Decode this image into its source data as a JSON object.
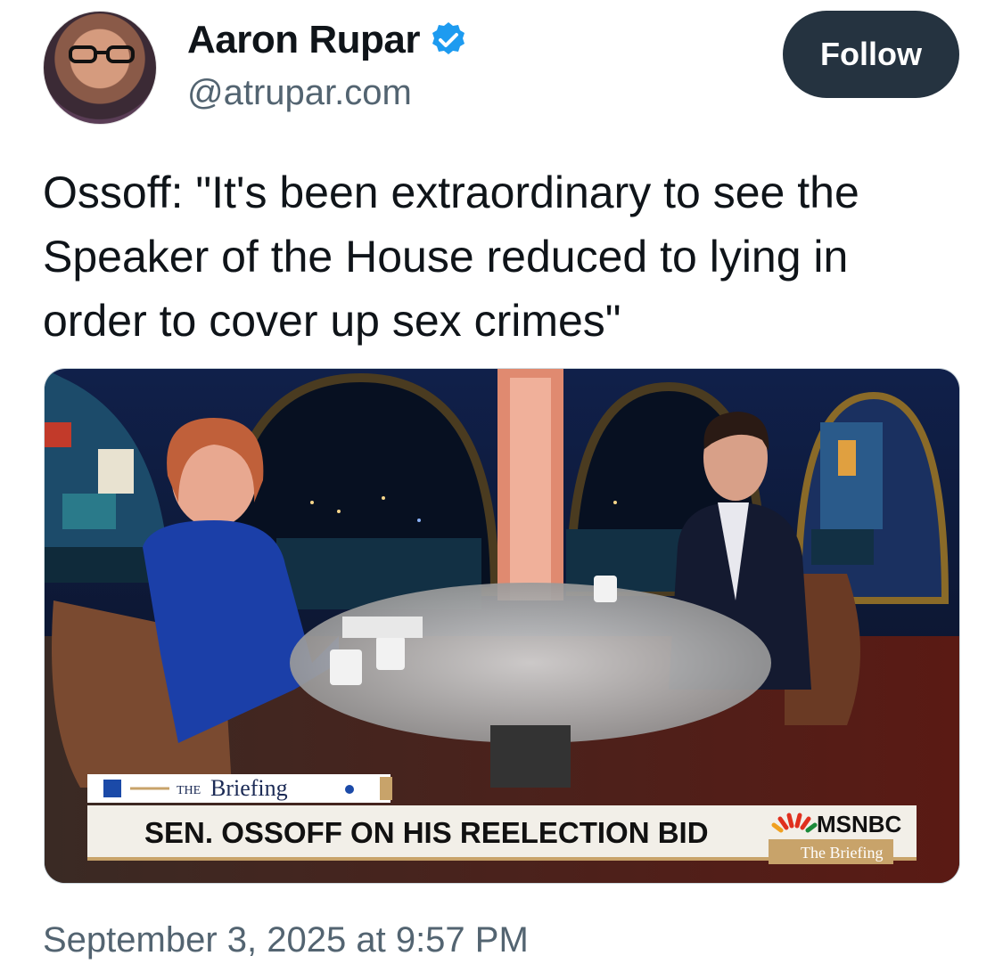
{
  "author": {
    "name": "Aaron Rupar",
    "handle": "@atrupar.com",
    "verified": true
  },
  "follow_label": "Follow",
  "tweet": {
    "text": "Ossoff: \"It's been extraordinary to see the Speaker of the House reduced to lying in order to cover up sex crimes\"",
    "timestamp": "September 3, 2025 at 9:57 PM"
  },
  "video": {
    "show_logo_the": "THE",
    "show_logo_briefing": "Briefing",
    "chyron": "SEN. OSSOFF ON HIS REELECTION BID",
    "network": "MSNBC",
    "network_show": "The Briefing"
  },
  "colors": {
    "follow_bg": "#253340",
    "verified_blue": "#1d9bf0",
    "secondary_text": "#536471"
  },
  "icons": {
    "verified": "verified-badge-icon",
    "network_logo": "peacock-icon"
  }
}
